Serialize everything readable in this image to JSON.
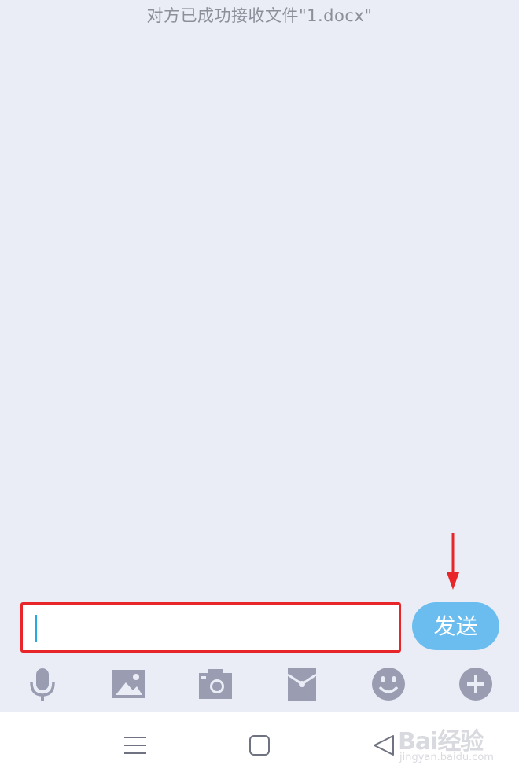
{
  "chat": {
    "system_notice": "对方已成功接收文件\"1.docx\""
  },
  "composer": {
    "input_value": "",
    "input_placeholder": "",
    "send_label": "发送"
  },
  "toolbar": {
    "items": [
      {
        "icon": "microphone-icon"
      },
      {
        "icon": "image-icon"
      },
      {
        "icon": "camera-icon"
      },
      {
        "icon": "red-packet-icon"
      },
      {
        "icon": "emoji-icon"
      },
      {
        "icon": "plus-icon"
      }
    ]
  },
  "navbar": {
    "items": [
      {
        "icon": "menu-icon"
      },
      {
        "icon": "home-icon"
      },
      {
        "icon": "back-icon"
      }
    ]
  },
  "annotation": {
    "arrow_color": "#e8262a",
    "highlight_color": "#e8262a"
  },
  "watermark": {
    "logo": "Bai经验",
    "url": "jingyan.baidu.com"
  },
  "colors": {
    "background": "#eaedf5",
    "send_button": "#6bbdf0",
    "icon": "#9a9db2",
    "caret": "#2aa9df"
  }
}
